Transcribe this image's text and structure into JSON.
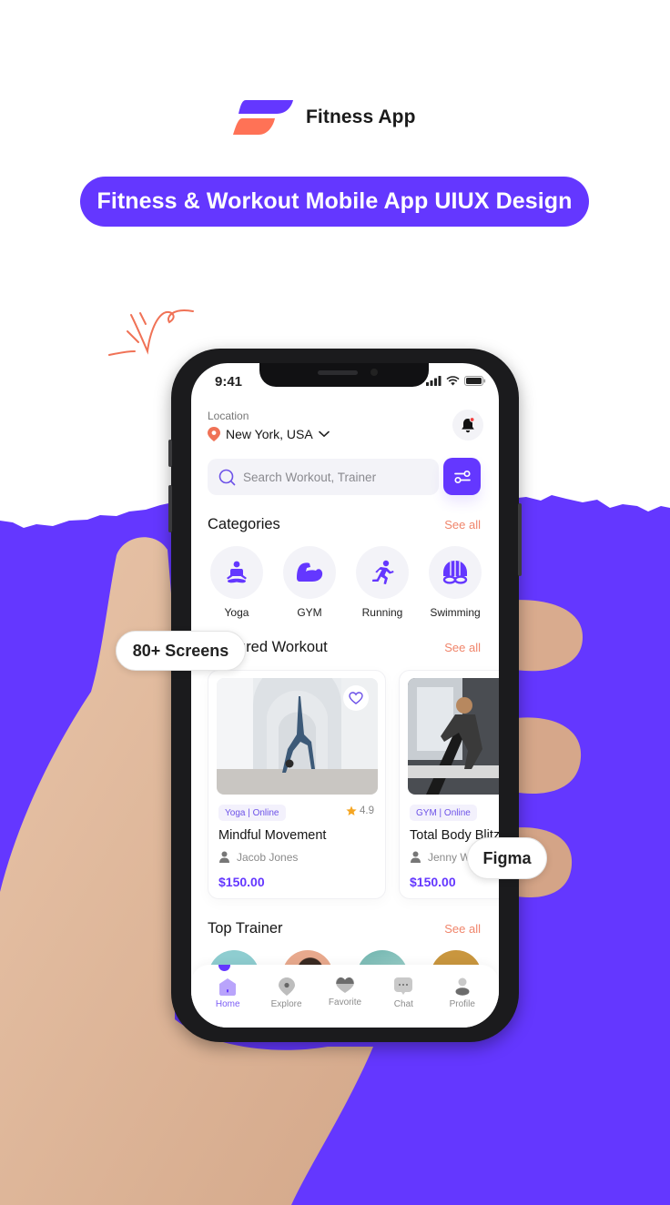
{
  "header": {
    "brand_name": "Fitness App",
    "banner_text": "Fitness & Workout Mobile App UIUX Design"
  },
  "colors": {
    "primary": "#6437FF",
    "accent": "#F0856B",
    "background": "#FFFFFF"
  },
  "badges": {
    "screens": "80+ Screens",
    "tool": "Figma"
  },
  "phone": {
    "status_bar": {
      "time": "9:41",
      "icons": [
        "signal-icon",
        "wifi-icon",
        "battery-icon"
      ]
    },
    "location": {
      "label": "Location",
      "value": "New York, USA"
    },
    "search": {
      "placeholder": "Search Workout, Trainer",
      "value": ""
    },
    "categories": {
      "title": "Categories",
      "see_all": "See all",
      "items": [
        {
          "label": "Yoga",
          "icon": "yoga-icon"
        },
        {
          "label": "GYM",
          "icon": "muscle-icon"
        },
        {
          "label": "Running",
          "icon": "running-icon"
        },
        {
          "label": "Swimming",
          "icon": "swimming-goggles-icon"
        }
      ]
    },
    "featured": {
      "title": "Featured Workout",
      "see_all": "See all",
      "cards": [
        {
          "tag": "Yoga | Online",
          "rating": "4.9",
          "title": "Mindful Movement",
          "trainer": "Jacob Jones",
          "price": "$150.00"
        },
        {
          "tag": "GYM | Online",
          "rating": "",
          "title": "Total Body Blitz",
          "trainer": "Jenny Wilson",
          "price": "$150.00"
        }
      ]
    },
    "top_trainer": {
      "title": "Top Trainer",
      "see_all": "See all"
    },
    "tabbar": {
      "active": "Home",
      "items": [
        {
          "label": "Home",
          "icon": "home-icon"
        },
        {
          "label": "Explore",
          "icon": "explore-icon"
        },
        {
          "label": "Favorite",
          "icon": "heart-icon"
        },
        {
          "label": "Chat",
          "icon": "chat-icon"
        },
        {
          "label": "Profile",
          "icon": "profile-icon"
        }
      ]
    }
  }
}
